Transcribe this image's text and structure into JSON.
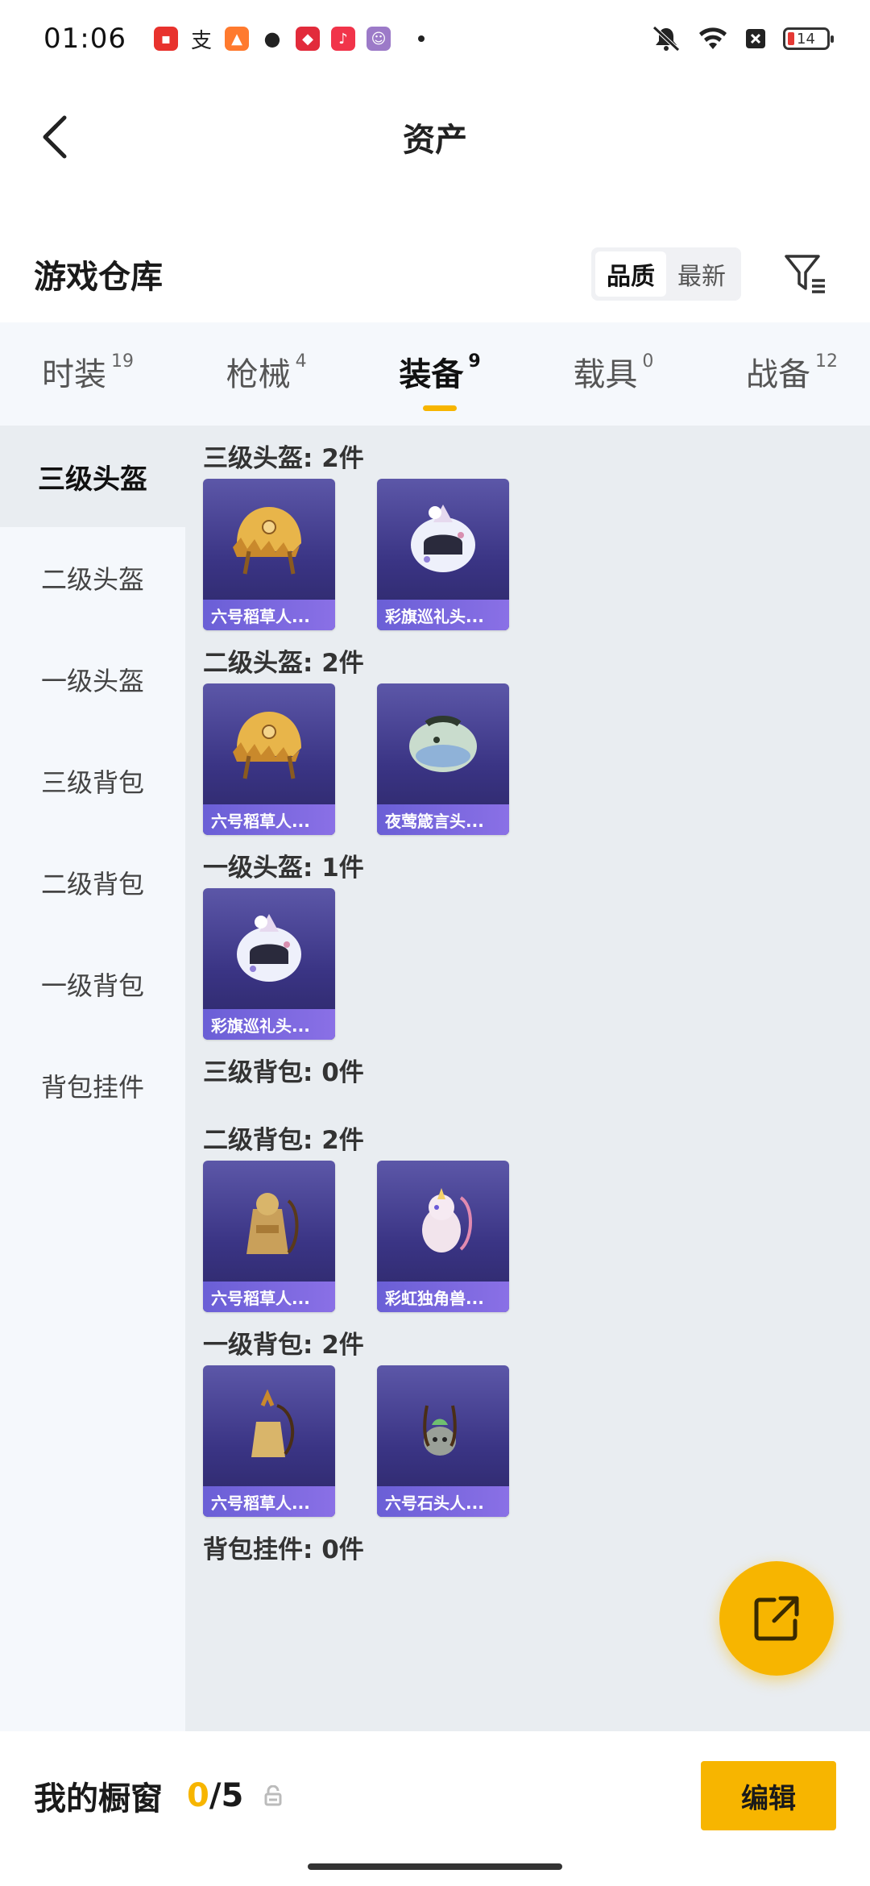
{
  "status_bar": {
    "time": "01:06",
    "battery_level": "14",
    "icons": [
      "notification-icons",
      "mute-icon",
      "wifi-icon",
      "sim-icon",
      "battery-icon"
    ]
  },
  "header": {
    "title": "资产"
  },
  "section": {
    "title": "游戏仓库",
    "sort_options": [
      "品质",
      "最新"
    ],
    "sort_selected": "品质"
  },
  "tabs": [
    {
      "label": "时装",
      "count": "19"
    },
    {
      "label": "枪械",
      "count": "4"
    },
    {
      "label": "装备",
      "count": "9"
    },
    {
      "label": "载具",
      "count": "0"
    },
    {
      "label": "战备",
      "count": "12"
    }
  ],
  "active_tab": "装备",
  "sidebar": {
    "items": [
      "三级头盔",
      "二级头盔",
      "一级头盔",
      "三级背包",
      "二级背包",
      "一级背包",
      "背包挂件"
    ],
    "active": "三级头盔"
  },
  "groups": [
    {
      "title": "三级头盔: 2件",
      "items": [
        {
          "name": "六号稻草人...",
          "type": "helmet-straw"
        },
        {
          "name": "彩旗巡礼头...",
          "type": "helmet-white"
        }
      ]
    },
    {
      "title": "二级头盔: 2件",
      "items": [
        {
          "name": "六号稻草人...",
          "type": "helmet-straw"
        },
        {
          "name": "夜莺箴言头...",
          "type": "helmet-green"
        }
      ]
    },
    {
      "title": "一级头盔: 1件",
      "items": [
        {
          "name": "彩旗巡礼头...",
          "type": "helmet-white"
        }
      ]
    },
    {
      "title": "三级背包: 0件",
      "items": []
    },
    {
      "title": "二级背包: 2件",
      "items": [
        {
          "name": "六号稻草人...",
          "type": "bag-straw"
        },
        {
          "name": "彩虹独角兽...",
          "type": "bag-unicorn"
        }
      ]
    },
    {
      "title": "一级背包: 2件",
      "items": [
        {
          "name": "六号稻草人...",
          "type": "bag-straw-small"
        },
        {
          "name": "六号石头人...",
          "type": "bag-stone"
        }
      ]
    },
    {
      "title": "背包挂件: 0件",
      "items": []
    }
  ],
  "footer": {
    "label": "我的橱窗",
    "current": "0",
    "separator": "/",
    "max": "5",
    "edit_label": "编辑"
  },
  "colors": {
    "accent": "#f7b500",
    "card_top": "#5c57a8",
    "card_bottom": "#2c2766",
    "card_label": "#7a68de"
  }
}
